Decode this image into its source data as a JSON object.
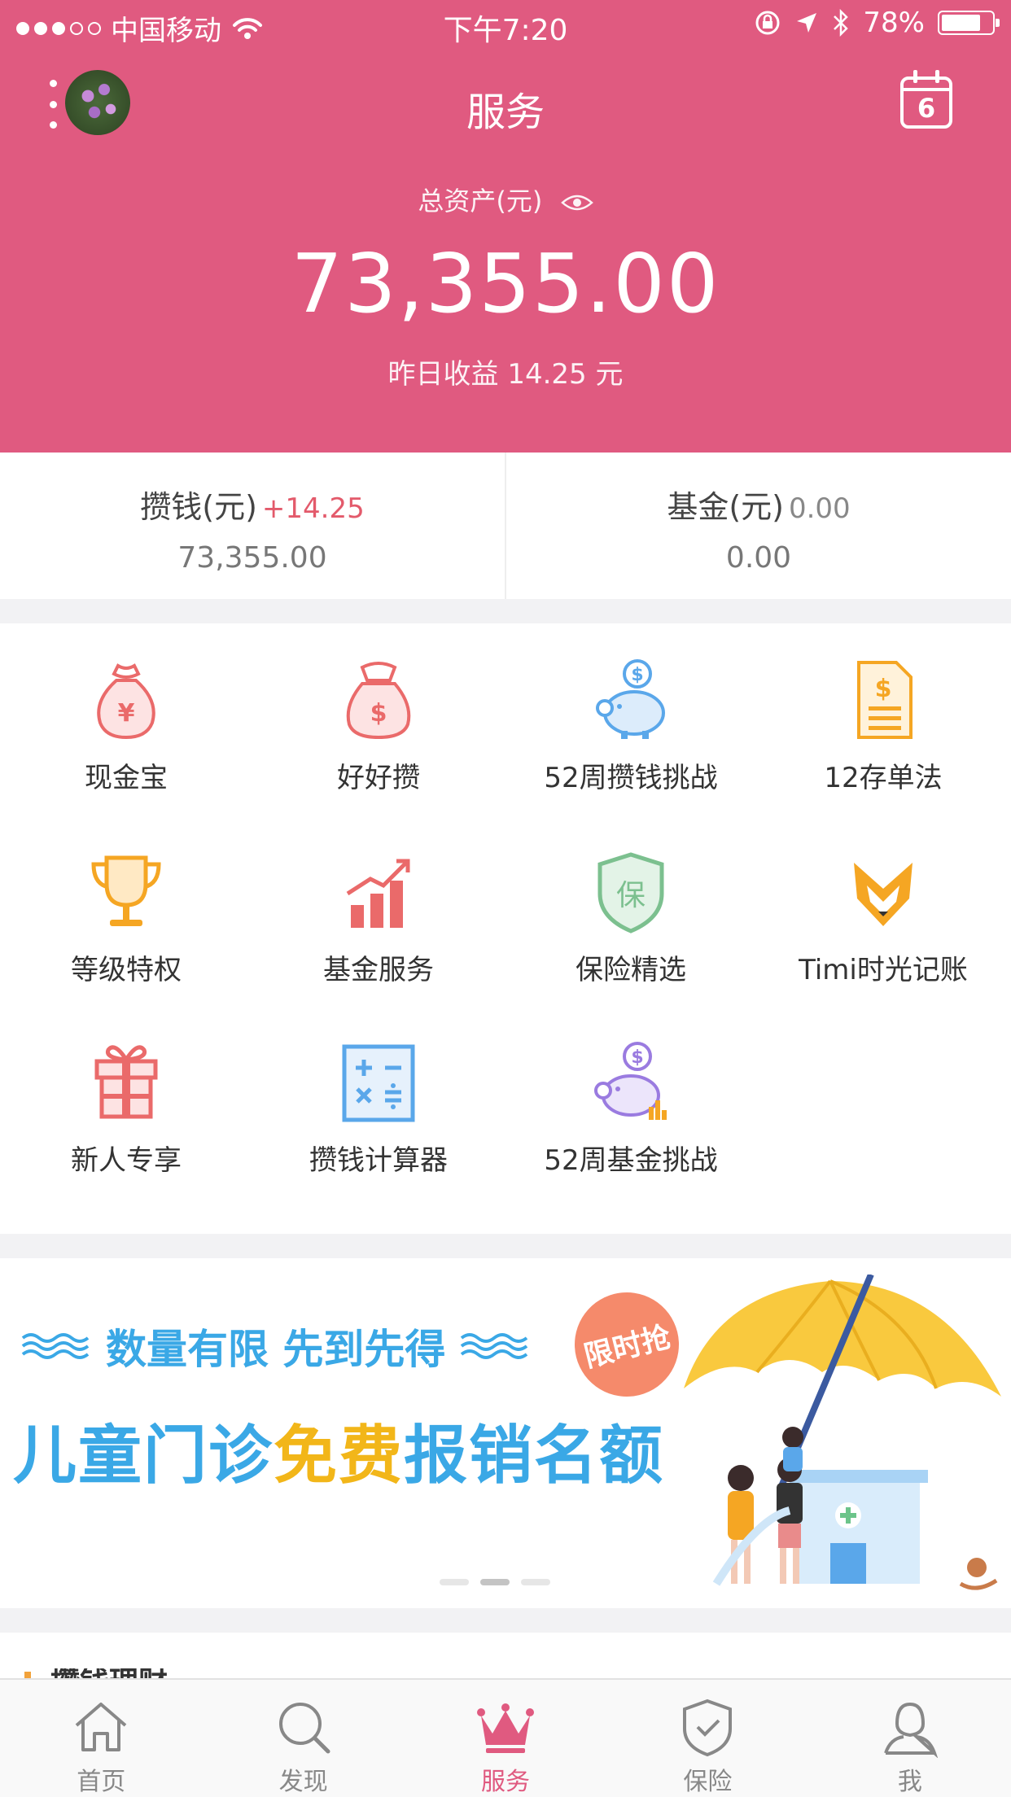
{
  "status_bar": {
    "carrier": "中国移动",
    "time": "下午7:20",
    "battery": "78%",
    "battery_level": 0.78
  },
  "nav": {
    "title": "服务",
    "calendar_day": "6"
  },
  "assets": {
    "label": "总资产(元)",
    "value": "73,355.00",
    "yesterday": "昨日收益 14.25 元"
  },
  "summary": [
    {
      "title": "攒钱(元)",
      "change": "+14.25",
      "value": "73,355.00"
    },
    {
      "title": "基金(元)",
      "change": "0.00",
      "value": "0.00"
    }
  ],
  "grid": [
    {
      "label": "现金宝",
      "icon": "money-bag-icon"
    },
    {
      "label": "好好攒",
      "icon": "dollar-bag-icon"
    },
    {
      "label": "52周攒钱挑战",
      "icon": "piggy-bank-icon"
    },
    {
      "label": "12存单法",
      "icon": "document-dollar-icon"
    },
    {
      "label": "等级特权",
      "icon": "trophy-icon"
    },
    {
      "label": "基金服务",
      "icon": "bar-chart-icon"
    },
    {
      "label": "保险精选",
      "icon": "shield-icon"
    },
    {
      "label": "Timi时光记账",
      "icon": "fox-icon"
    },
    {
      "label": "新人专享",
      "icon": "gift-icon"
    },
    {
      "label": "攒钱计算器",
      "icon": "calculator-icon"
    },
    {
      "label": "52周基金挑战",
      "icon": "piggy-chart-icon"
    }
  ],
  "banner": {
    "line1": "数量有限 先到先得",
    "line2_prefix": "儿童门诊",
    "line2_highlight": "免费",
    "line2_suffix": "报销名额",
    "badge": "限时抢",
    "pages": 3,
    "active_page": 2
  },
  "section": {
    "title": "攒钱理财"
  },
  "tabbar": [
    {
      "label": "首页",
      "icon": "home-icon",
      "active": false
    },
    {
      "label": "发现",
      "icon": "search-icon",
      "active": false
    },
    {
      "label": "服务",
      "icon": "crown-icon",
      "active": true
    },
    {
      "label": "保险",
      "icon": "shield-check-icon",
      "active": false
    },
    {
      "label": "我",
      "icon": "user-icon",
      "active": false
    }
  ],
  "colors": {
    "brand": "#e05a80",
    "red_icon": "#ea6a6a",
    "blue_icon": "#5aa7ea",
    "orange_icon": "#f5a623",
    "green_icon": "#7cc08f",
    "purple_icon": "#9a7be0",
    "banner_blue": "#3aa8e6",
    "banner_yellow": "#f2b619"
  }
}
